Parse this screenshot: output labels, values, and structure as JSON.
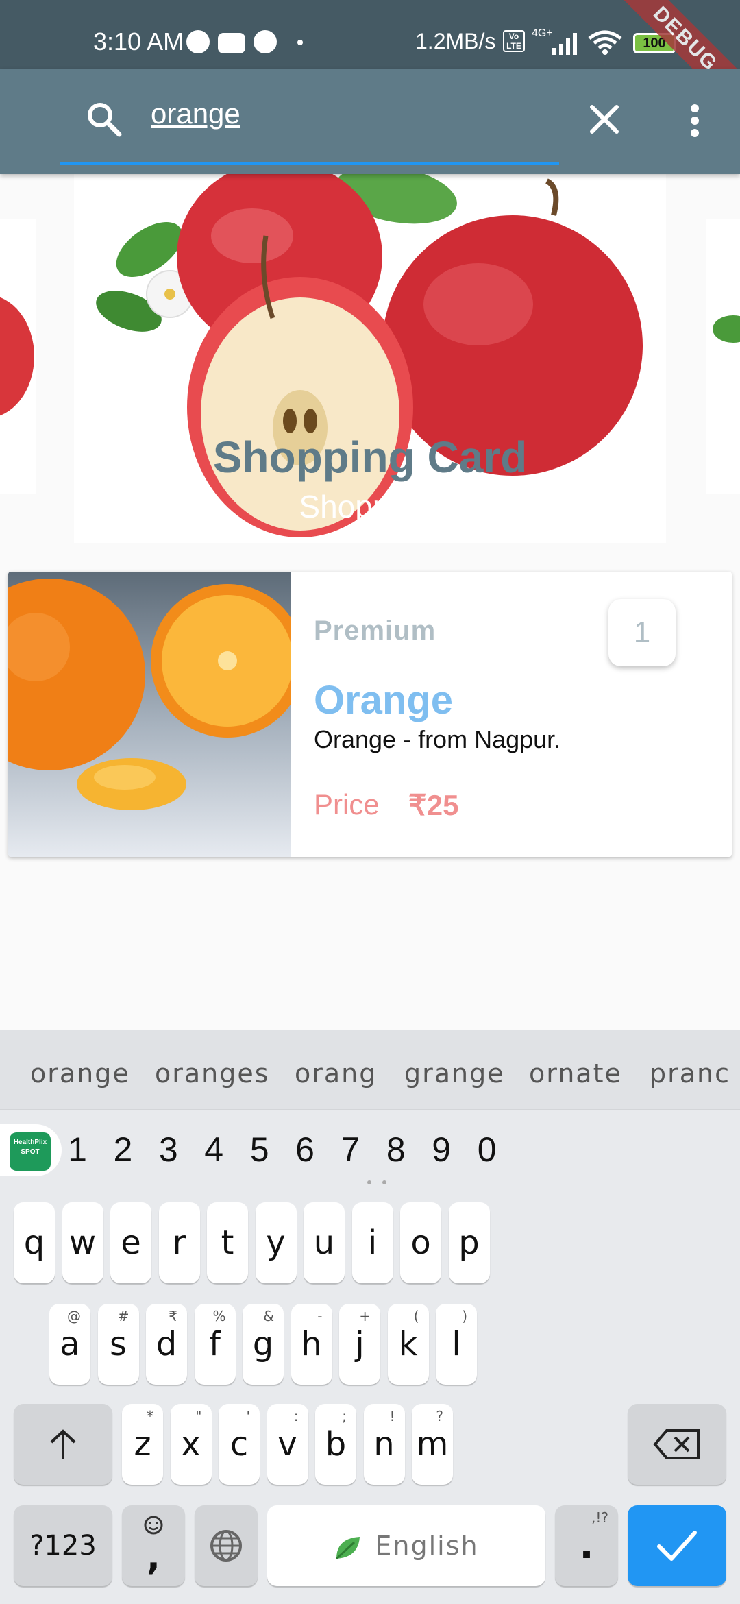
{
  "status_bar": {
    "time": "3:10 AM",
    "net_speed": "1.2MB/s",
    "volte": "Vo LTE",
    "network": "4G+",
    "battery": "100",
    "debug_banner": "DEBUG"
  },
  "search": {
    "query": "orange",
    "search_icon": "search-icon",
    "clear_icon": "close-icon",
    "menu_icon": "more-vert-icon",
    "accent_color": "#2196f3"
  },
  "banner": {
    "title": "Shopping Card",
    "subtitle": "Shopping!"
  },
  "product": {
    "tag": "Premium",
    "quantity": "1",
    "name": "Orange",
    "description": "Orange - from Nagpur.",
    "price_label": "Price",
    "price": "₹25"
  },
  "keyboard": {
    "suggestions": [
      "orange",
      "oranges",
      "orang",
      "grange",
      "ornate",
      "pranc"
    ],
    "numbers": [
      "1",
      "2",
      "3",
      "4",
      "5",
      "6",
      "7",
      "8",
      "9",
      "0"
    ],
    "row1": [
      {
        "k": "q",
        "h": ""
      },
      {
        "k": "w",
        "h": ""
      },
      {
        "k": "e",
        "h": ""
      },
      {
        "k": "r",
        "h": ""
      },
      {
        "k": "t",
        "h": ""
      },
      {
        "k": "y",
        "h": ""
      },
      {
        "k": "u",
        "h": ""
      },
      {
        "k": "i",
        "h": ""
      },
      {
        "k": "o",
        "h": ""
      },
      {
        "k": "p",
        "h": ""
      }
    ],
    "row2": [
      {
        "k": "a",
        "h": "@"
      },
      {
        "k": "s",
        "h": "#"
      },
      {
        "k": "d",
        "h": "₹"
      },
      {
        "k": "f",
        "h": "%"
      },
      {
        "k": "g",
        "h": "&"
      },
      {
        "k": "h",
        "h": "-"
      },
      {
        "k": "j",
        "h": "+"
      },
      {
        "k": "k",
        "h": "("
      },
      {
        "k": "l",
        "h": ")"
      }
    ],
    "row3": [
      {
        "k": "z",
        "h": "*"
      },
      {
        "k": "x",
        "h": "\""
      },
      {
        "k": "c",
        "h": "'"
      },
      {
        "k": "v",
        "h": ":"
      },
      {
        "k": "b",
        "h": ";"
      },
      {
        "k": "n",
        "h": "!"
      },
      {
        "k": "m",
        "h": "?"
      }
    ],
    "symbols_label": "?123",
    "comma": ",",
    "space_label": "English",
    "period": ".",
    "period_hint": ",!?",
    "sticker_text": "HealthPlix SPOT"
  }
}
